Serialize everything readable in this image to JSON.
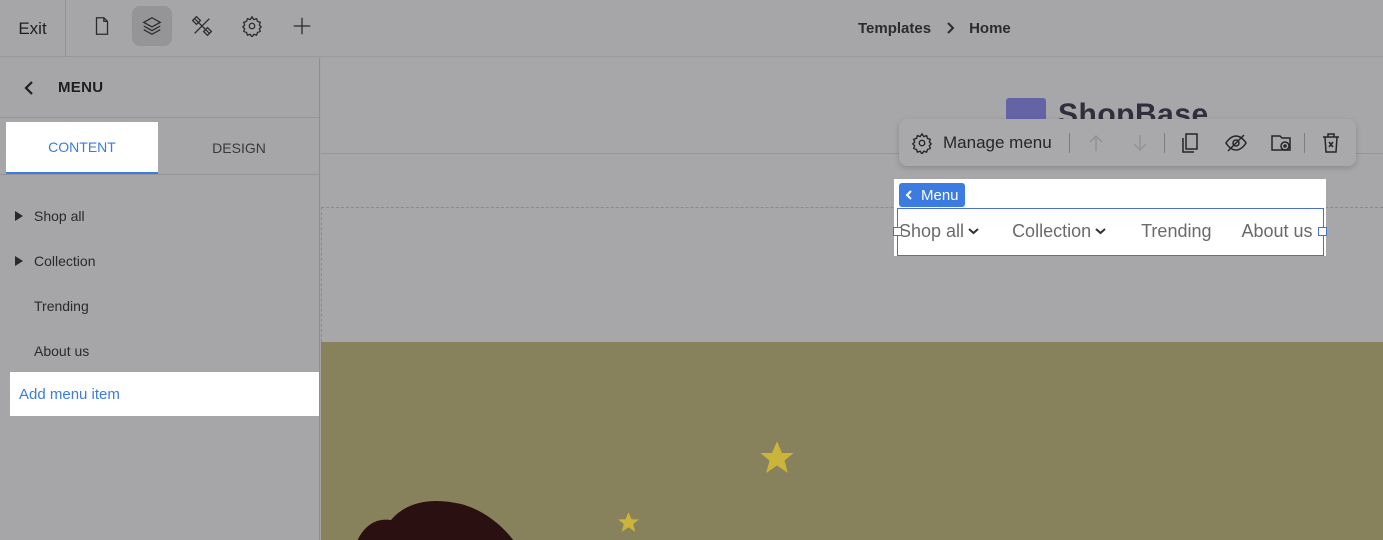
{
  "topbar": {
    "exit_label": "Exit",
    "tools": [
      "page-icon",
      "layers-icon",
      "design-tools-icon",
      "gear-icon",
      "plus-icon"
    ],
    "active_tool": "layers-icon",
    "breadcrumb": {
      "parent": "Templates",
      "current": "Home"
    }
  },
  "sidebar": {
    "title": "MENU",
    "tabs": {
      "content": "CONTENT",
      "design": "DESIGN",
      "active": "CONTENT"
    },
    "items": [
      {
        "label": "Shop all",
        "has_children": true
      },
      {
        "label": "Collection",
        "has_children": true
      },
      {
        "label": "Trending",
        "has_children": false
      },
      {
        "label": "About us",
        "has_children": false
      }
    ],
    "add_item_label": "Add menu item"
  },
  "canvas": {
    "logo_text": "ShopBase",
    "toolbar": {
      "manage_label": "Manage menu",
      "icons": [
        "arrow-up-icon",
        "arrow-down-icon",
        "duplicate-icon",
        "hide-icon",
        "add-section-icon",
        "delete-icon"
      ]
    },
    "menu_badge": "Menu",
    "nav": {
      "items": [
        {
          "label": "Shop all",
          "dropdown": true
        },
        {
          "label": "Collection",
          "dropdown": true
        },
        {
          "label": "Trending",
          "dropdown": false
        },
        {
          "label": "About us",
          "dropdown": false
        }
      ]
    }
  },
  "colors": {
    "accent": "#3b7be2",
    "overlay": "#a6a6a8",
    "hero": "#87825b",
    "star": "#cbb43a"
  }
}
